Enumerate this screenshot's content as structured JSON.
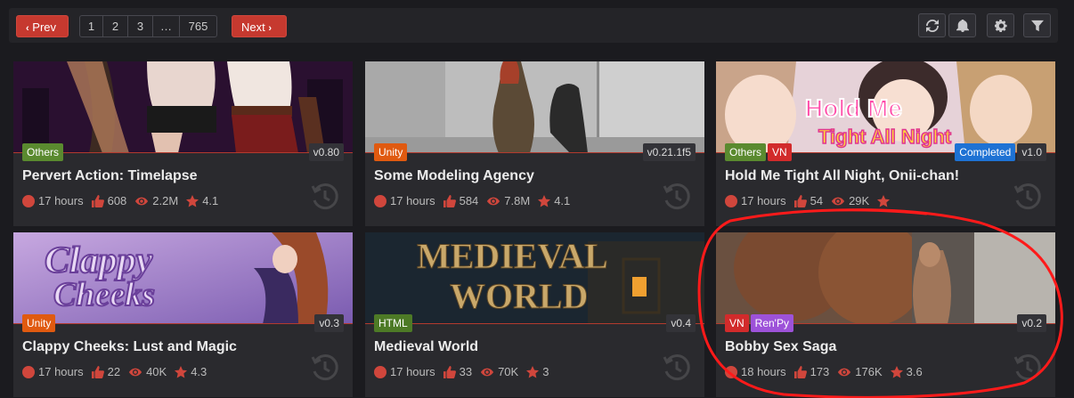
{
  "pagination": {
    "prev_label": "Prev",
    "next_label": "Next",
    "pages": [
      "1",
      "2",
      "3",
      "…",
      "765"
    ]
  },
  "toolbar": {
    "icons": [
      "refresh-icon",
      "bell-icon",
      "gear-icon",
      "filter-icon"
    ]
  },
  "games": [
    {
      "title": "Pervert Action: Timelapse",
      "tags": [
        "Others"
      ],
      "status": "",
      "version": "v0.80",
      "time": "17 hours",
      "likes": "608",
      "views": "2.2M",
      "rating": "4.1"
    },
    {
      "title": "Some Modeling Agency",
      "tags": [
        "Unity"
      ],
      "status": "",
      "version": "v0.21.1f5",
      "time": "17 hours",
      "likes": "584",
      "views": "7.8M",
      "rating": "4.1"
    },
    {
      "title": "Hold Me Tight All Night, Onii-chan!",
      "tags": [
        "Others",
        "VN"
      ],
      "status": "Completed",
      "version": "v1.0",
      "time": "17 hours",
      "likes": "54",
      "views": "29K",
      "rating": ""
    },
    {
      "title": "Clappy Cheeks: Lust and Magic",
      "tags": [
        "Unity"
      ],
      "status": "",
      "version": "v0.3",
      "time": "17 hours",
      "likes": "22",
      "views": "40K",
      "rating": "4.3"
    },
    {
      "title": "Medieval World",
      "tags": [
        "HTML"
      ],
      "status": "",
      "version": "v0.4",
      "time": "17 hours",
      "likes": "33",
      "views": "70K",
      "rating": "3"
    },
    {
      "title": "Bobby Sex Saga",
      "tags": [
        "VN",
        "Ren'Py"
      ],
      "status": "",
      "version": "v0.2",
      "time": "18 hours",
      "likes": "173",
      "views": "176K",
      "rating": "3.6"
    }
  ],
  "thumbnails": {
    "clappy_logo_line1": "Clappy",
    "clappy_logo_line2": "Cheeks",
    "medieval_logo_line1": "MEDIEVAL",
    "medieval_logo_line2": "WORLD",
    "holdme_logo_line1": "Hold Me",
    "holdme_logo_line2": "Tight All Night"
  },
  "colors": {
    "accent": "#c6392f",
    "background": "#1b1b1f",
    "card": "#2a2a2e",
    "annotation": "#ff1a1a"
  }
}
